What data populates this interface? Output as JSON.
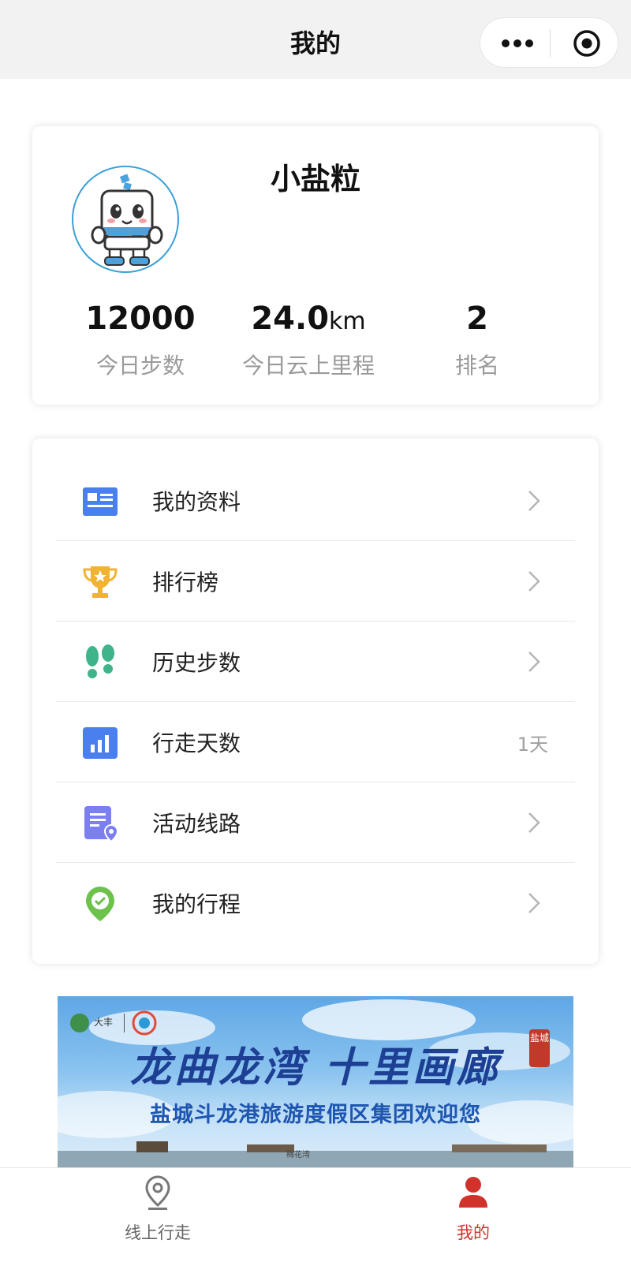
{
  "header": {
    "title": "我的"
  },
  "profile": {
    "nickname": "小盐粒",
    "stats": [
      {
        "value": "12000",
        "unit": "",
        "label": "今日步数"
      },
      {
        "value": "24.0",
        "unit": "km",
        "label": "今日云上里程"
      },
      {
        "value": "2",
        "unit": "",
        "label": "排名"
      }
    ]
  },
  "menu": {
    "items": [
      {
        "label": "我的资料",
        "icon": "profile-card-icon",
        "value": ""
      },
      {
        "label": "排行榜",
        "icon": "trophy-icon",
        "value": ""
      },
      {
        "label": "历史步数",
        "icon": "footprints-icon",
        "value": ""
      },
      {
        "label": "行走天数",
        "icon": "bar-chart-icon",
        "value": "1天"
      },
      {
        "label": "活动线路",
        "icon": "route-list-icon",
        "value": ""
      },
      {
        "label": "我的行程",
        "icon": "location-check-icon",
        "value": ""
      }
    ]
  },
  "banner": {
    "title": "龙曲龙湾 十里画廊",
    "subtitle": "盐城斗龙港旅游度假区集团欢迎您",
    "seal": "盐城",
    "logo_text": "大丰",
    "caption": "梅花湾"
  },
  "tabbar": {
    "items": [
      {
        "label": "线上行走",
        "icon": "location-pin-icon",
        "active": false
      },
      {
        "label": "我的",
        "icon": "user-icon",
        "active": true
      }
    ]
  },
  "colors": {
    "accent_red": "#d1322b",
    "avatar_border": "#3aa0d8",
    "menu_blue": "#4a7ff0",
    "trophy_gold": "#f2b233",
    "footprint_green": "#3fb389",
    "route_purple": "#7b7ff0",
    "check_green": "#6cc24a"
  }
}
